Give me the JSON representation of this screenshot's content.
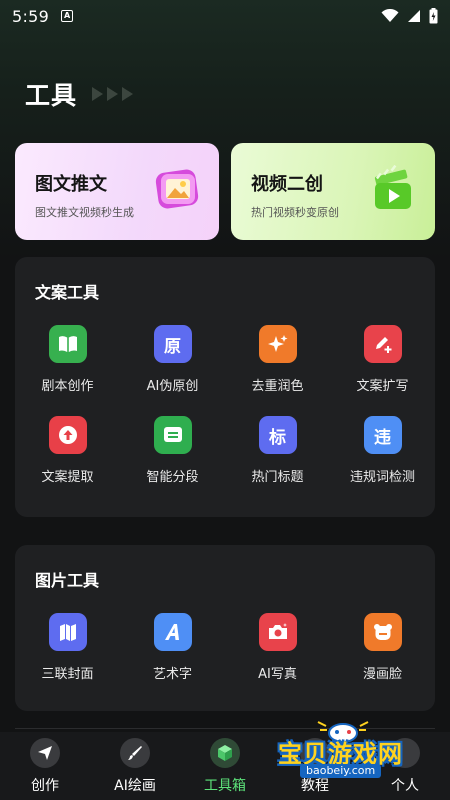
{
  "status_bar": {
    "time": "5:59",
    "notif_icon": "A"
  },
  "header": {
    "title": "工具"
  },
  "feature_cards": [
    {
      "title": "图文推文",
      "subtitle": "图文推文视频秒生成"
    },
    {
      "title": "视频二创",
      "subtitle": "热门视频秒变原创"
    }
  ],
  "text_tools": {
    "title": "文案工具",
    "items": [
      {
        "label": "剧本创作",
        "glyph": ""
      },
      {
        "label": "AI伪原创",
        "glyph": "原"
      },
      {
        "label": "去重润色",
        "glyph": ""
      },
      {
        "label": "文案扩写",
        "glyph": ""
      },
      {
        "label": "文案提取",
        "glyph": ""
      },
      {
        "label": "智能分段",
        "glyph": ""
      },
      {
        "label": "热门标题",
        "glyph": "标"
      },
      {
        "label": "违规词检测",
        "glyph": "违"
      }
    ]
  },
  "image_tools": {
    "title": "图片工具",
    "items": [
      {
        "label": "三联封面",
        "glyph": ""
      },
      {
        "label": "艺术字",
        "glyph": ""
      },
      {
        "label": "AI写真",
        "glyph": ""
      },
      {
        "label": "漫画脸",
        "glyph": ""
      }
    ]
  },
  "nav": {
    "items": [
      {
        "label": "创作"
      },
      {
        "label": "AI绘画"
      },
      {
        "label": "工具箱"
      },
      {
        "label": "教程"
      },
      {
        "label": "个人"
      }
    ]
  },
  "watermark": {
    "text": "宝贝游戏网",
    "url": "baobeiy.com"
  },
  "colors": {
    "accent_green": "#5de27a",
    "panel_bg": "#1f2022",
    "page_bg": "#121314"
  }
}
